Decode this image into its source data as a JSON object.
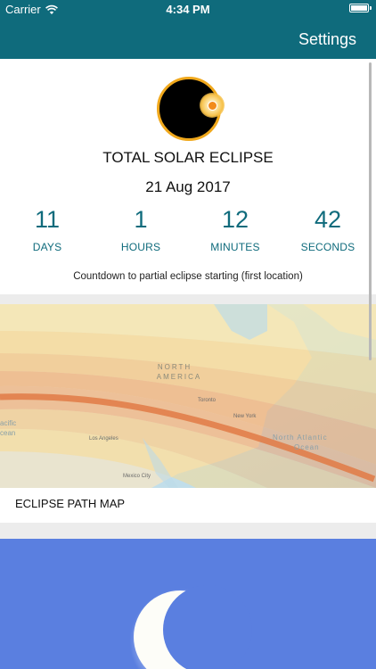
{
  "status_bar": {
    "carrier": "Carrier",
    "time": "4:34 PM"
  },
  "nav": {
    "settings_label": "Settings"
  },
  "eclipse": {
    "title": "TOTAL SOLAR ECLIPSE",
    "date": "21 Aug 2017",
    "countdown": [
      {
        "value": "11",
        "unit": "DAYS"
      },
      {
        "value": "1",
        "unit": "HOURS"
      },
      {
        "value": "12",
        "unit": "MINUTES"
      },
      {
        "value": "42",
        "unit": "SECONDS"
      }
    ],
    "caption": "Countdown to partial eclipse starting (first location)"
  },
  "map": {
    "caption": "ECLIPSE PATH MAP",
    "labels": {
      "continent_line1": "NORTH",
      "continent_line2": "AMERICA",
      "city_toronto": "Toronto",
      "city_new_york": "New York",
      "city_los_angeles": "Los Angeles",
      "city_mexico": "Mexico City",
      "ocean_atlantic_line1": "North Atlantic",
      "ocean_atlantic_line2": "Ocean",
      "ocean_pacific_line1": "acific",
      "ocean_pacific_line2": "cean"
    }
  },
  "colors": {
    "nav_bg": "#0f6b7c",
    "accent": "#0f6b7c",
    "moon_card_bg": "#5a7fe0",
    "eclipse_ring": "#f0a81c"
  }
}
